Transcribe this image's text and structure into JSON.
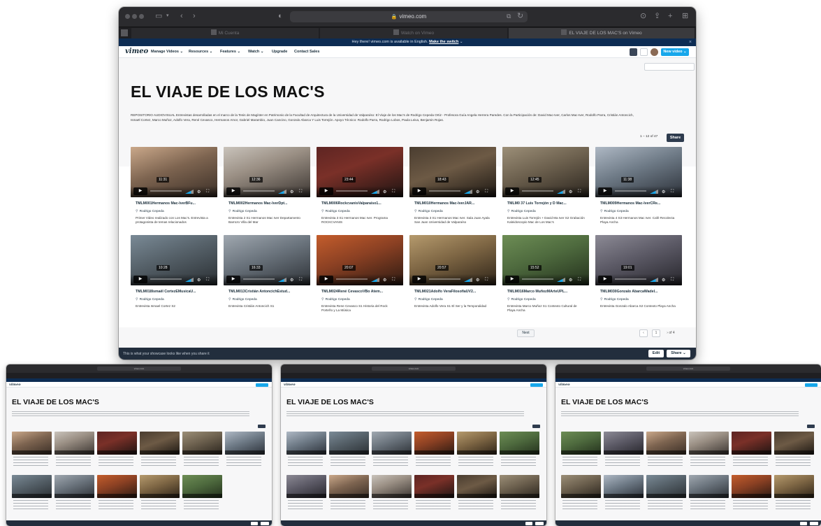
{
  "browser": {
    "url": "vimeo.com",
    "tabs": [
      {
        "label": "Mi Cuenta",
        "active": false
      },
      {
        "label": "Watch on Vimeo",
        "active": false
      },
      {
        "label": "EL VIAJE DE LOS MAC'S on Vimeo",
        "active": true
      }
    ]
  },
  "banner": {
    "text": "Hey there! vimeo.com is available in English.",
    "link": "Make the switch"
  },
  "nav": {
    "logo": "vimeo",
    "items": [
      "Manage Videos",
      "Resources",
      "Features",
      "Watch",
      "Upgrade",
      "Contact Sales"
    ],
    "new_video": "New video"
  },
  "showcase": {
    "title": "EL VIAJE DE LOS MAC'S",
    "description": "REPOSITORIO AUDIOVISUAL Entrevistas desarrolladas en el marco de la Tesis de Magíster en Patrimonio de la Facultad de Arquitectura de la Universidad de Valparaíso: El Viaje de los Mac's de Rodrigo Cepeda Ortiz - Profesora Guía Angela Herrera Paredes. Con la Participación de: David Mac-Iver, Carlos Mac-Iver, Rodolfo Parra, Cristián Antoncich, Ismaël Cortez, Marco Muñoz, Adolfo Vera, René Cevasco, Hermanos Amor, Gabriel Marambio, Juan Cancino, Gonzalo Abarca Y Luis Torrejón. Apoyo Técnico: Rodolfo Parra, Rodrigo Lobos, Paula Leiva, Benjamin Rojas.",
    "count": "1 – 12 of 47",
    "share": "Share"
  },
  "videos": [
    {
      "title": "TMLM001Hermanos Mac-IverBFu...",
      "user": "Rodrigo Cepeda",
      "desc": "Primer Video realizado con Los Mac's. Entrevista a protagonista de temas relacionados",
      "duration": "11:31"
    },
    {
      "title": "TMLM002Hermanos Mac-IverDpt...",
      "user": "Rodrigo Cepeda",
      "desc": "Entrevista 2 S1 Hermanos Mac Iver Departamento Barrozo Villa del Mar",
      "duration": "12:36"
    },
    {
      "title": "TMLM006RockcvanisValparaíso1...",
      "user": "Rodrigo Cepeda",
      "desc": "Entrevista 3 S1 Hermanos Mac Iver. Programa ROCKCVANIS",
      "duration": "23:44"
    },
    {
      "title": "TMLM010Hermanos Mac-IverJAR...",
      "user": "Rodrigo Cepeda",
      "desc": "Entrevista 3 S1 Hermanos Mac Iver. Sala Juan Ayala San Juan Universidad de Valparaíso",
      "duration": "18:43"
    },
    {
      "title": "TMLM0 37 Luis Torrejón y D Mac...",
      "user": "Rodrigo Cepeda",
      "desc": "Entrevista Luis Torrejón + David Ma Iver S2 Grabación Kaleidoscopio Mac de Los Mac's",
      "duration": "12:45"
    },
    {
      "title": "TMLM009Hermanos Mac-IverCRe...",
      "user": "Rodrigo Cepeda",
      "desc": "Entrevista 4 S3 Hermanos Mac Iver. Café Recolecta Playa Ancha",
      "duration": "11:38"
    },
    {
      "title": "TMLM018Ismaël CortezEMusicaU...",
      "user": "Rodrigo Cepeda",
      "desc": "Entrevista Ismael Cortez S2",
      "duration": "10:28"
    },
    {
      "title": "TMLM013Cristián AntoncichEstud...",
      "user": "Rodrigo Cepeda",
      "desc": "Entrevista Cristián Antoncich S1",
      "duration": "16:33"
    },
    {
      "title": "TMLM024René CevascoVBo Atem...",
      "user": "Rodrigo Cepeda",
      "desc": "Entrevista Rene Cevasco S1 Historia del Rock Porteño y La Música",
      "duration": "20:07"
    },
    {
      "title": "TMLM021Adolfo VeraFilosofíaUV2...",
      "user": "Rodrigo Cepeda",
      "desc": "Entrevista Adolfo Vera S1 El Ser y la Temporalidad",
      "duration": "20:57"
    },
    {
      "title": "TMLM016Marco MuñozMArteUPL...",
      "user": "Rodrigo Cepeda",
      "desc": "Entrevista Marco Muñoz S1 Contexto Cultural de Playa Ancha",
      "duration": "15:52"
    },
    {
      "title": "TMLM030Gonzalo AbarcaWadel...",
      "user": "Rodrigo Cepeda",
      "desc": "Entrevista Gonzalo Abarca S2 Contexto Playa Ancha",
      "duration": "19:01"
    }
  ],
  "pagination": {
    "next": "Next",
    "page": "1",
    "of": "of 4"
  },
  "footer": {
    "text": "This is what your showcase looks like when you share it",
    "edit": "Edit",
    "share": "Share"
  },
  "mini_windows": [
    {
      "title": "EL VIAJE DE LOS MAC'S",
      "url": "vimeo.com"
    },
    {
      "title": "EL VIAJE DE LOS MAC'S",
      "url": "vimeo.com"
    },
    {
      "title": "EL VIAJE DE LOS MAC'S",
      "url": "vimeo.com"
    }
  ],
  "colors": {
    "accent": "#17a7eb",
    "dark_navy": "#222e3d",
    "banner": "#0d2c53"
  }
}
